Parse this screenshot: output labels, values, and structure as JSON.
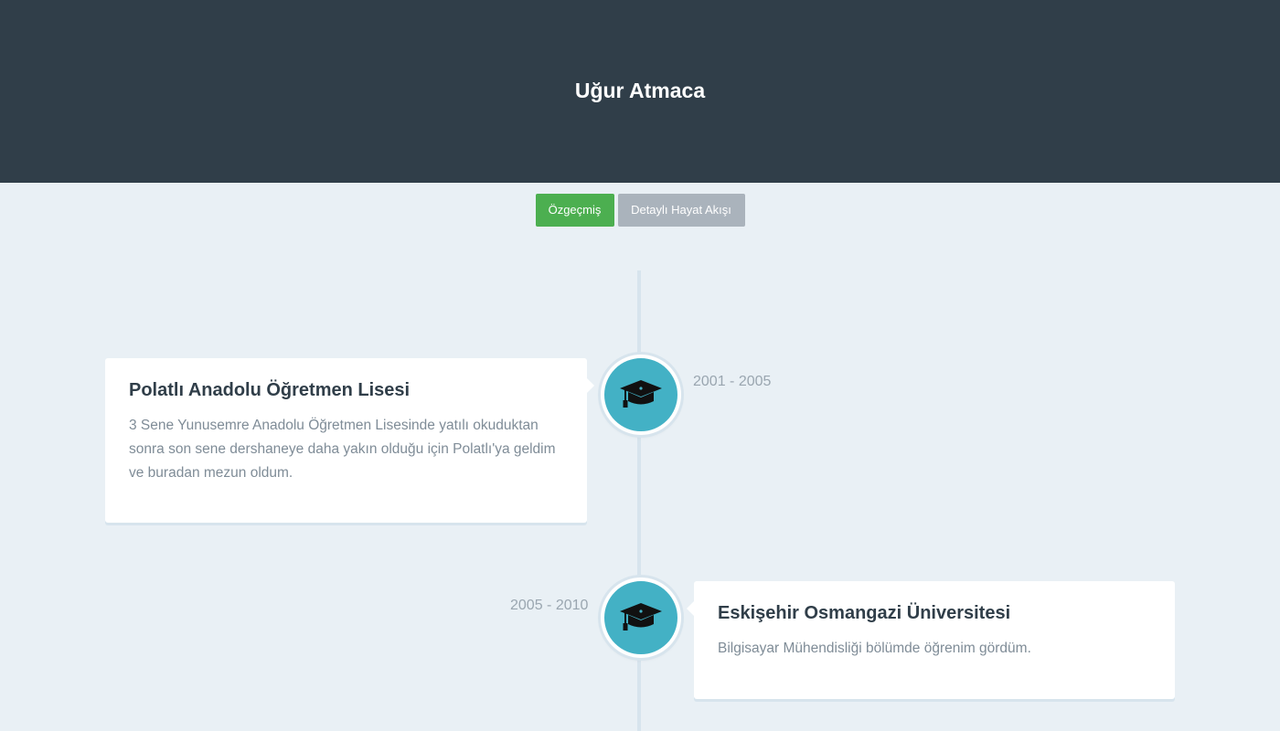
{
  "header": {
    "title": "Uğur Atmaca"
  },
  "nav": {
    "buttons": [
      {
        "label": "Özgeçmiş",
        "color": "#4caf50"
      },
      {
        "label": "Detaylı Hayat Akışı",
        "color": "#aab3bc"
      }
    ]
  },
  "timeline": {
    "icon": "graduation-cap-icon",
    "node_color": "#43b1c5",
    "items": [
      {
        "date": "2001 - 2005",
        "title": "Polatlı Anadolu Öğretmen Lisesi",
        "text": "3 Sene Yunusemre Anadolu Öğretmen Lisesinde yatılı okuduktan sonra son sene dershaneye daha yakın olduğu için Polatlı'ya geldim ve buradan mezun oldum."
      },
      {
        "date": "2005 - 2010",
        "title": "Eskişehir Osmangazi Üniversitesi",
        "text": "Bilgisayar Mühendisliği bölümde öğrenim gördüm."
      }
    ]
  }
}
